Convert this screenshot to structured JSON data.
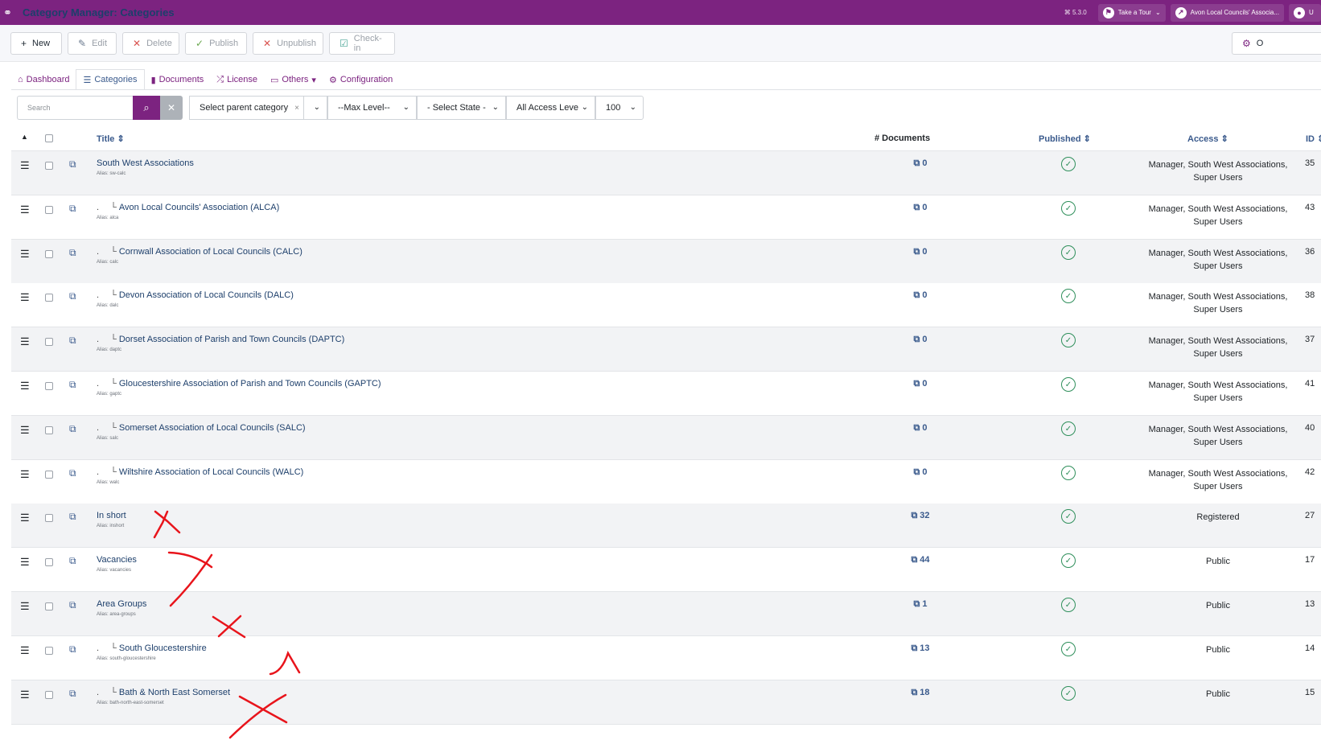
{
  "header": {
    "title": "Category Manager: Categories",
    "version": "⌘ 5.3.0",
    "tour_label": "Take a Tour",
    "site_label": "Avon Local Councils' Associa...",
    "user_label": "U"
  },
  "toolbar": {
    "new": "New",
    "edit": "Edit",
    "delete": "Delete",
    "publish": "Publish",
    "unpublish": "Unpublish",
    "checkin": "Check-in",
    "options": "O"
  },
  "tabs": [
    "Dashboard",
    "Categories",
    "Documents",
    "License",
    "Others",
    "Configuration"
  ],
  "filters": {
    "search_placeholder": "Search",
    "parent": "Select parent category",
    "max_level": "--Max Level--",
    "state": "- Select State -",
    "access": "All Access Leve",
    "limit": "100"
  },
  "columns": {
    "title": "Title",
    "documents": "# Documents",
    "published": "Published",
    "access": "Access",
    "id": "ID"
  },
  "rows": [
    {
      "title": "South West Associations",
      "alias": "Alias: sw-calc",
      "child": false,
      "docs": "0",
      "access": "Manager, South West Associations, Super Users",
      "id": "35"
    },
    {
      "title": "Avon Local Councils' Association (ALCA)",
      "alias": "Alias: alca",
      "child": true,
      "docs": "0",
      "access": "Manager, South West Associations, Super Users",
      "id": "43"
    },
    {
      "title": "Cornwall Association of Local Councils (CALC)",
      "alias": "Alias: calc",
      "child": true,
      "docs": "0",
      "access": "Manager, South West Associations, Super Users",
      "id": "36"
    },
    {
      "title": "Devon Association of Local Councils (DALC)",
      "alias": "Alias: dalc",
      "child": true,
      "docs": "0",
      "access": "Manager, South West Associations, Super Users",
      "id": "38"
    },
    {
      "title": "Dorset Association of Parish and Town Councils (DAPTC)",
      "alias": "Alias: daptc",
      "child": true,
      "docs": "0",
      "access": "Manager, South West Associations, Super Users",
      "id": "37"
    },
    {
      "title": "Gloucestershire Association of Parish and Town Councils (GAPTC)",
      "alias": "Alias: gaptc",
      "child": true,
      "docs": "0",
      "access": "Manager, South West Associations, Super Users",
      "id": "41"
    },
    {
      "title": "Somerset Association of Local Councils (SALC)",
      "alias": "Alias: salc",
      "child": true,
      "docs": "0",
      "access": "Manager, South West Associations, Super Users",
      "id": "40"
    },
    {
      "title": "Wiltshire Association of Local Councils (WALC)",
      "alias": "Alias: walc",
      "child": true,
      "docs": "0",
      "access": "Manager, South West Associations, Super Users",
      "id": "42"
    },
    {
      "title": "In short",
      "alias": "Alias: inshort",
      "child": false,
      "docs": "32",
      "access": "Registered",
      "id": "27"
    },
    {
      "title": "Vacancies",
      "alias": "Alias: vacancies",
      "child": false,
      "docs": "44",
      "access": "Public",
      "id": "17"
    },
    {
      "title": "Area Groups",
      "alias": "Alias: area-groups",
      "child": false,
      "docs": "1",
      "access": "Public",
      "id": "13"
    },
    {
      "title": "South Gloucestershire",
      "alias": "Alias: south-gloucestershire",
      "child": true,
      "docs": "13",
      "access": "Public",
      "id": "14"
    },
    {
      "title": "Bath & North East Somerset",
      "alias": "Alias: bath-north-east-somerset",
      "child": true,
      "docs": "18",
      "access": "Public",
      "id": "15"
    }
  ]
}
